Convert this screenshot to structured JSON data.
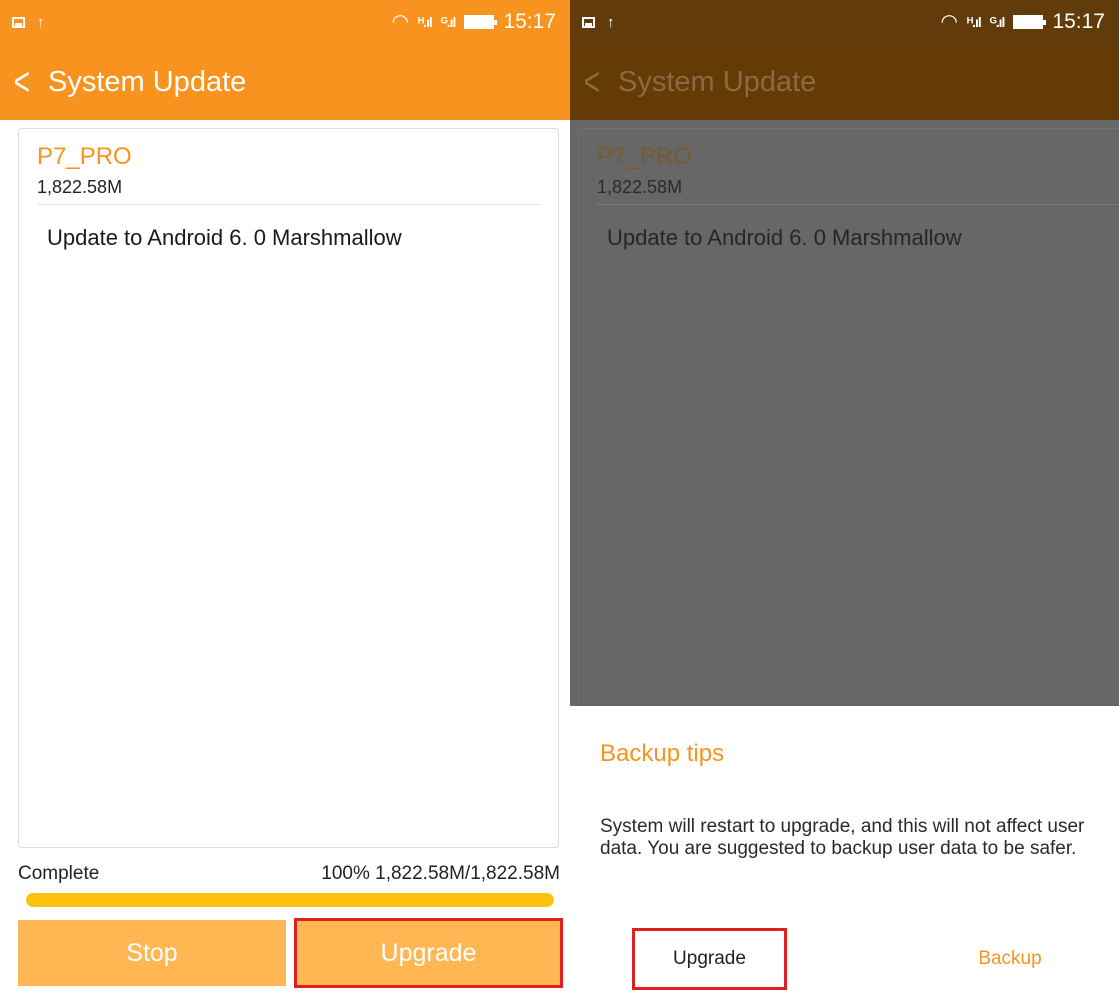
{
  "status_bar": {
    "time": "15:17",
    "signal_1": "ᴴ.ıl",
    "signal_2": "ᴳ.ıl",
    "icons": [
      "image-notification-icon",
      "upload-icon",
      "wifi-icon",
      "signal-icon",
      "signal-icon",
      "battery-icon"
    ]
  },
  "header": {
    "title": "System Update",
    "back_icon": "chevron-left-icon"
  },
  "update": {
    "package_name": "P7_PRO",
    "size": "1,822.58M",
    "description": "Update to Android 6. 0 Marshmallow"
  },
  "progress": {
    "label": "Complete",
    "detail": "100% 1,822.58M/1,822.58M",
    "fraction": 1.0
  },
  "buttons": {
    "stop": "Stop",
    "upgrade": "Upgrade"
  },
  "dialog": {
    "title": "Backup tips",
    "message": "System will restart to upgrade, and this will not affect user data. You are suggested to backup user data to be safer.",
    "upgrade": "Upgrade",
    "backup": "Backup"
  },
  "colors": {
    "accent": "#f7931e",
    "progress_fill": "#fcc20d",
    "button_bg": "#ffb653",
    "highlight": "#e02020"
  }
}
